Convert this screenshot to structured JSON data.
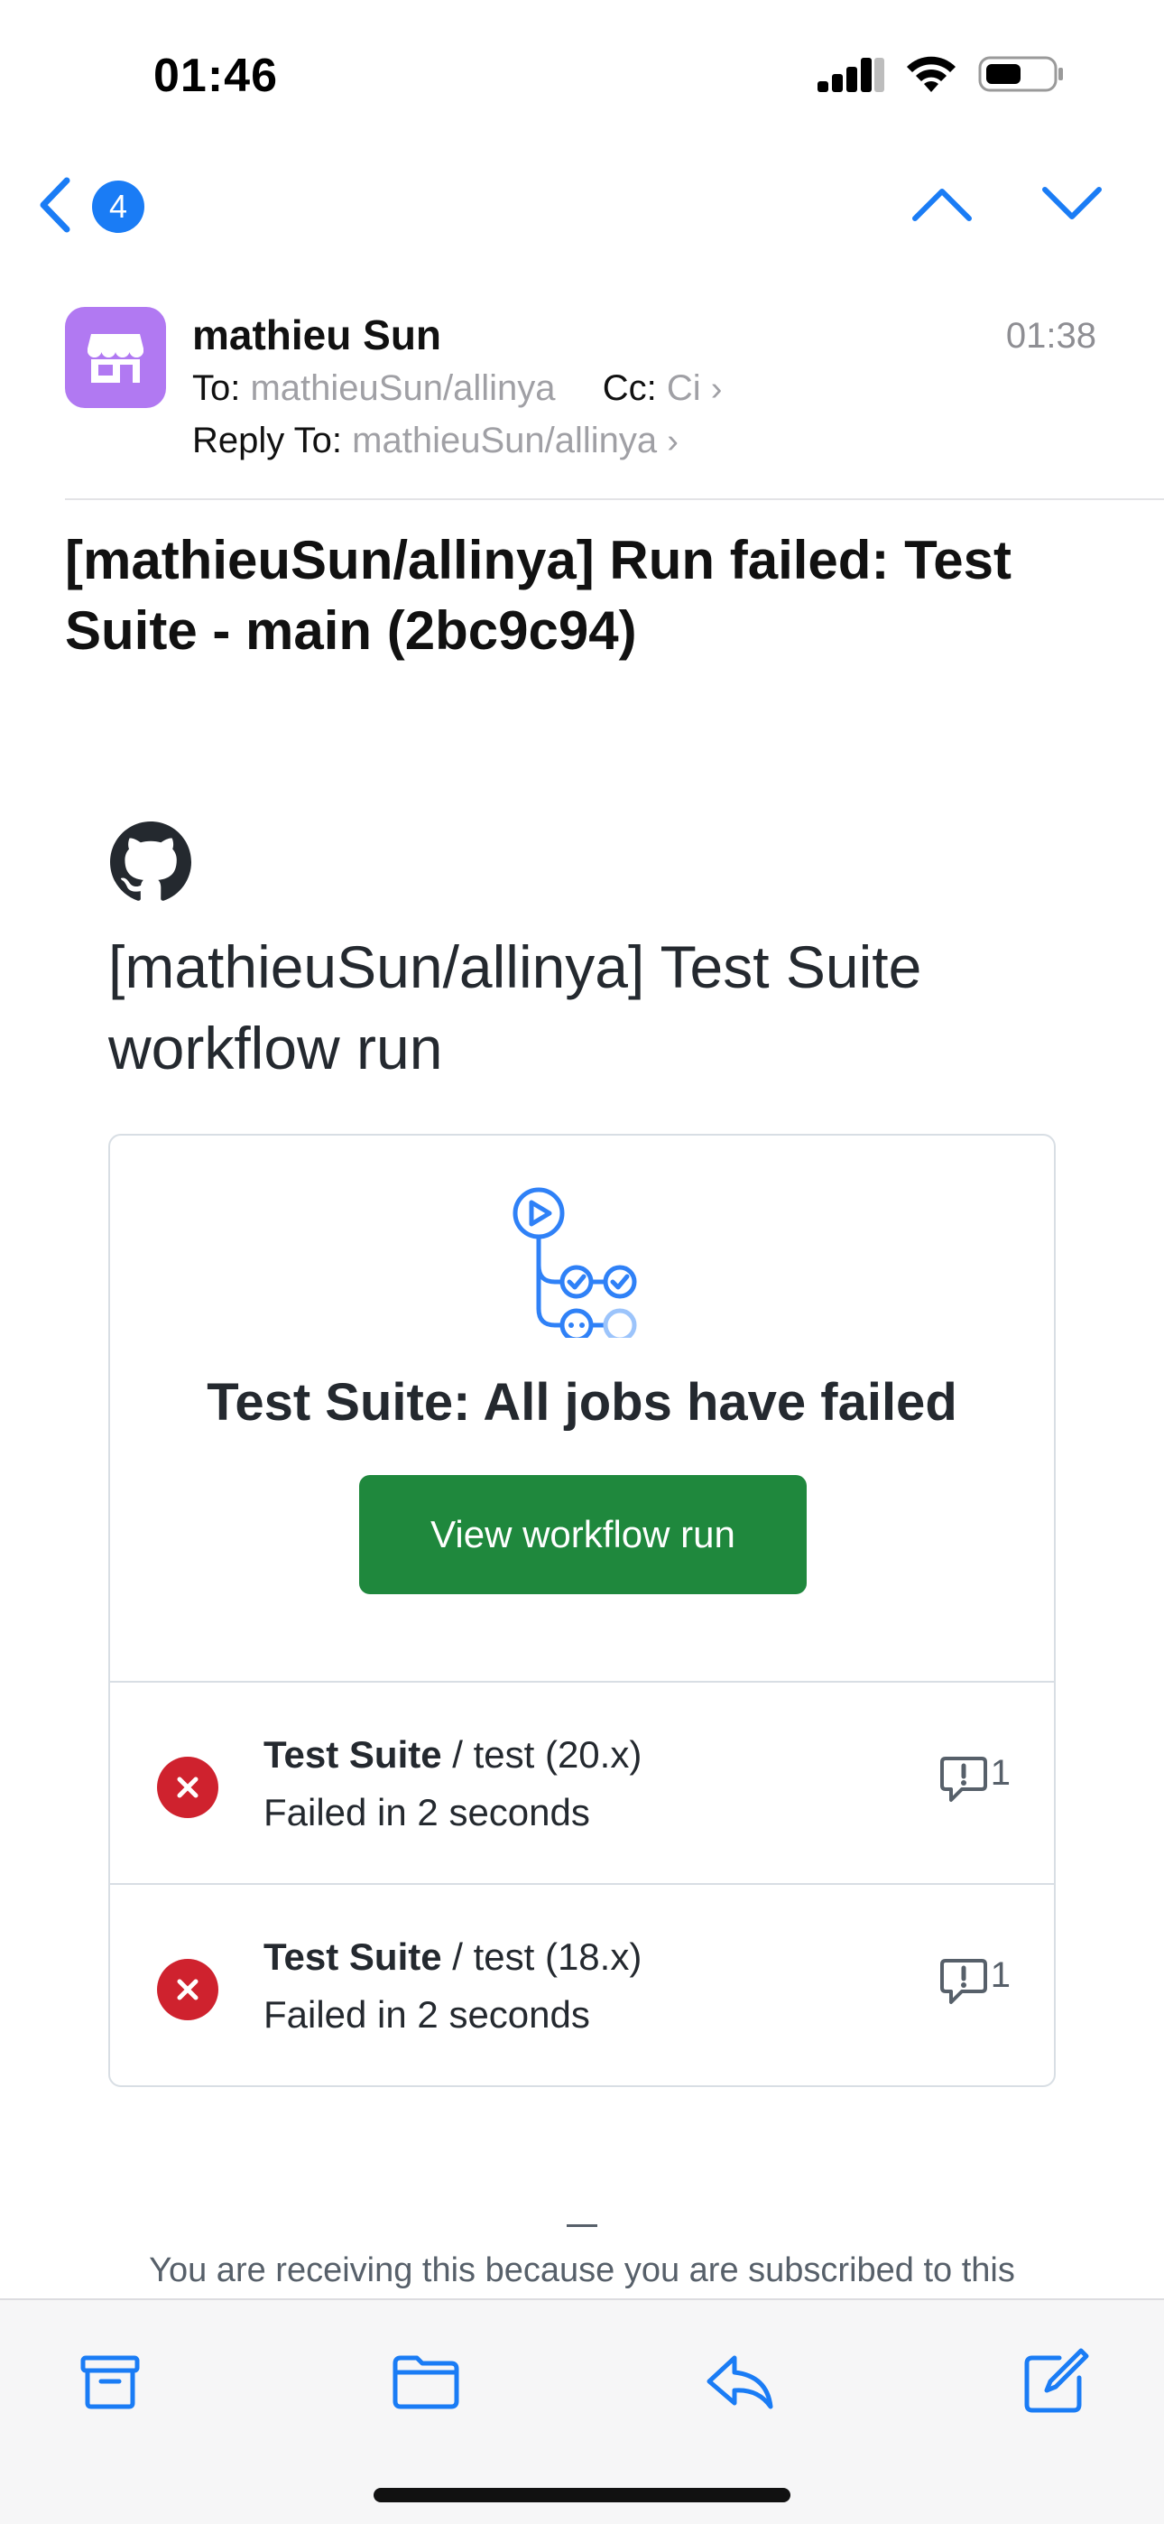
{
  "status_bar": {
    "time": "01:46"
  },
  "nav": {
    "unread_count": "4"
  },
  "email": {
    "sender_name": "mathieu Sun",
    "time": "01:38",
    "to_label": "To:",
    "to_value": "mathieuSun/allinya",
    "cc_label": "Cc:",
    "cc_value": "Ci",
    "reply_to_label": "Reply To:",
    "reply_to_value": "mathieuSun/allinya",
    "subject": "[mathieuSun/allinya] Run failed: Test Suite - main (2bc9c94)"
  },
  "body": {
    "intro": "[mathieuSun/allinya] Test Suite workflow run",
    "card_title": "Test Suite: All jobs have failed",
    "button_label": "View workflow run",
    "jobs": [
      {
        "workflow": "Test Suite",
        "job": " / test (20.x)",
        "status": "Failed in 2 seconds",
        "annotations": "1"
      },
      {
        "workflow": "Test Suite",
        "job": " / test (18.x)",
        "status": "Failed in 2 seconds",
        "annotations": "1"
      }
    ],
    "footer": "You are receiving this because you are subscribed to this"
  },
  "colors": {
    "ios_blue": "#1a7cf5",
    "avatar": "#b179f2",
    "github_green": "#1f883d",
    "fail_red": "#cf222e",
    "workflow_icon_blue": "#2f81f7"
  },
  "icons": {
    "back": "chevron-left-icon",
    "prev": "chevron-up-icon",
    "next": "chevron-down-icon",
    "avatar": "storefront-icon",
    "logo": "github-logo-icon",
    "workflow": "workflow-icon",
    "fail": "x-circle-fill-icon",
    "annotation": "comment-alert-icon",
    "archive": "archive-box-icon",
    "folder": "folder-icon",
    "reply": "reply-icon",
    "compose": "compose-icon"
  }
}
